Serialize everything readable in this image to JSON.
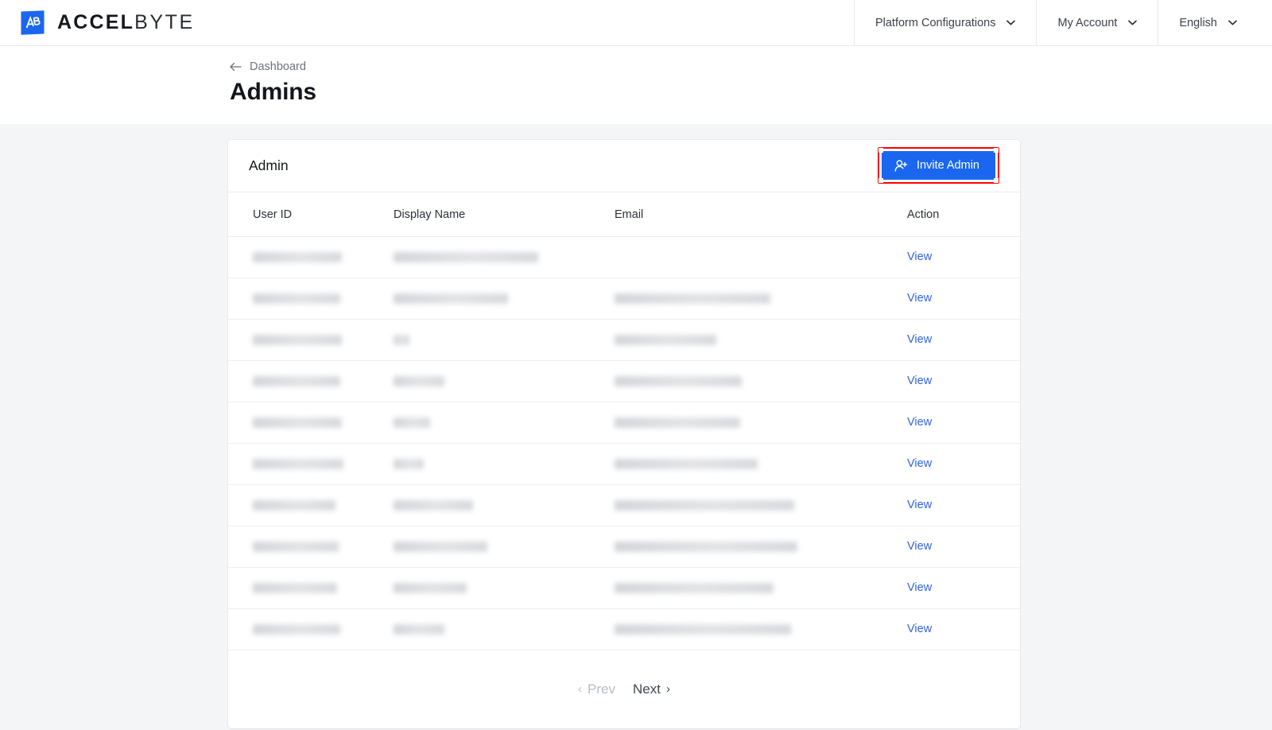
{
  "brand": {
    "name_bold": "ACCEL",
    "name_light": "BYTE",
    "logo_icon": "accelbyte-ab-monogram",
    "logo_color": "#1a66ef"
  },
  "topnav": {
    "items": [
      {
        "label": "Platform Configurations",
        "icon": "chevron-down-icon"
      },
      {
        "label": "My Account",
        "icon": "chevron-down-icon"
      },
      {
        "label": "English",
        "icon": "chevron-down-icon"
      }
    ]
  },
  "pagehead": {
    "breadcrumb_label": "Dashboard",
    "breadcrumb_icon": "arrow-left-icon",
    "title": "Admins"
  },
  "card": {
    "title": "Admin",
    "invite_button": {
      "label": "Invite Admin",
      "icon": "user-plus-icon",
      "background": "#1a66ef",
      "highlight_border": "#ff0000"
    }
  },
  "table": {
    "columns": [
      "User ID",
      "Display Name",
      "Email",
      "Action"
    ],
    "action_label": "View",
    "rows": [
      {
        "user_id": "",
        "display_name": "",
        "email": "",
        "action": "View",
        "redacted": true,
        "w_userid": 112,
        "w_display": 182,
        "w_email": 0
      },
      {
        "user_id": "",
        "display_name": "",
        "email": "",
        "action": "View",
        "redacted": true,
        "w_userid": 110,
        "w_display": 144,
        "w_email": 196
      },
      {
        "user_id": "",
        "display_name": "",
        "email": "",
        "action": "View",
        "redacted": true,
        "w_userid": 112,
        "w_display": 20,
        "w_email": 128
      },
      {
        "user_id": "",
        "display_name": "",
        "email": "",
        "action": "View",
        "redacted": true,
        "w_userid": 110,
        "w_display": 64,
        "w_email": 160
      },
      {
        "user_id": "",
        "display_name": "",
        "email": "",
        "action": "View",
        "redacted": true,
        "w_userid": 112,
        "w_display": 46,
        "w_email": 158
      },
      {
        "user_id": "",
        "display_name": "",
        "email": "",
        "action": "View",
        "redacted": true,
        "w_userid": 114,
        "w_display": 38,
        "w_email": 180
      },
      {
        "user_id": "",
        "display_name": "",
        "email": "",
        "action": "View",
        "redacted": true,
        "w_userid": 104,
        "w_display": 100,
        "w_email": 226
      },
      {
        "user_id": "",
        "display_name": "",
        "email": "",
        "action": "View",
        "redacted": true,
        "w_userid": 108,
        "w_display": 118,
        "w_email": 230
      },
      {
        "user_id": "",
        "display_name": "",
        "email": "",
        "action": "View",
        "redacted": true,
        "w_userid": 106,
        "w_display": 92,
        "w_email": 200
      },
      {
        "user_id": "",
        "display_name": "",
        "email": "",
        "action": "View",
        "redacted": true,
        "w_userid": 110,
        "w_display": 64,
        "w_email": 222
      }
    ]
  },
  "pagination": {
    "prev_label": "Prev",
    "prev_chevron": "‹",
    "prev_disabled": true,
    "next_label": "Next",
    "next_chevron": "›",
    "next_disabled": false
  }
}
